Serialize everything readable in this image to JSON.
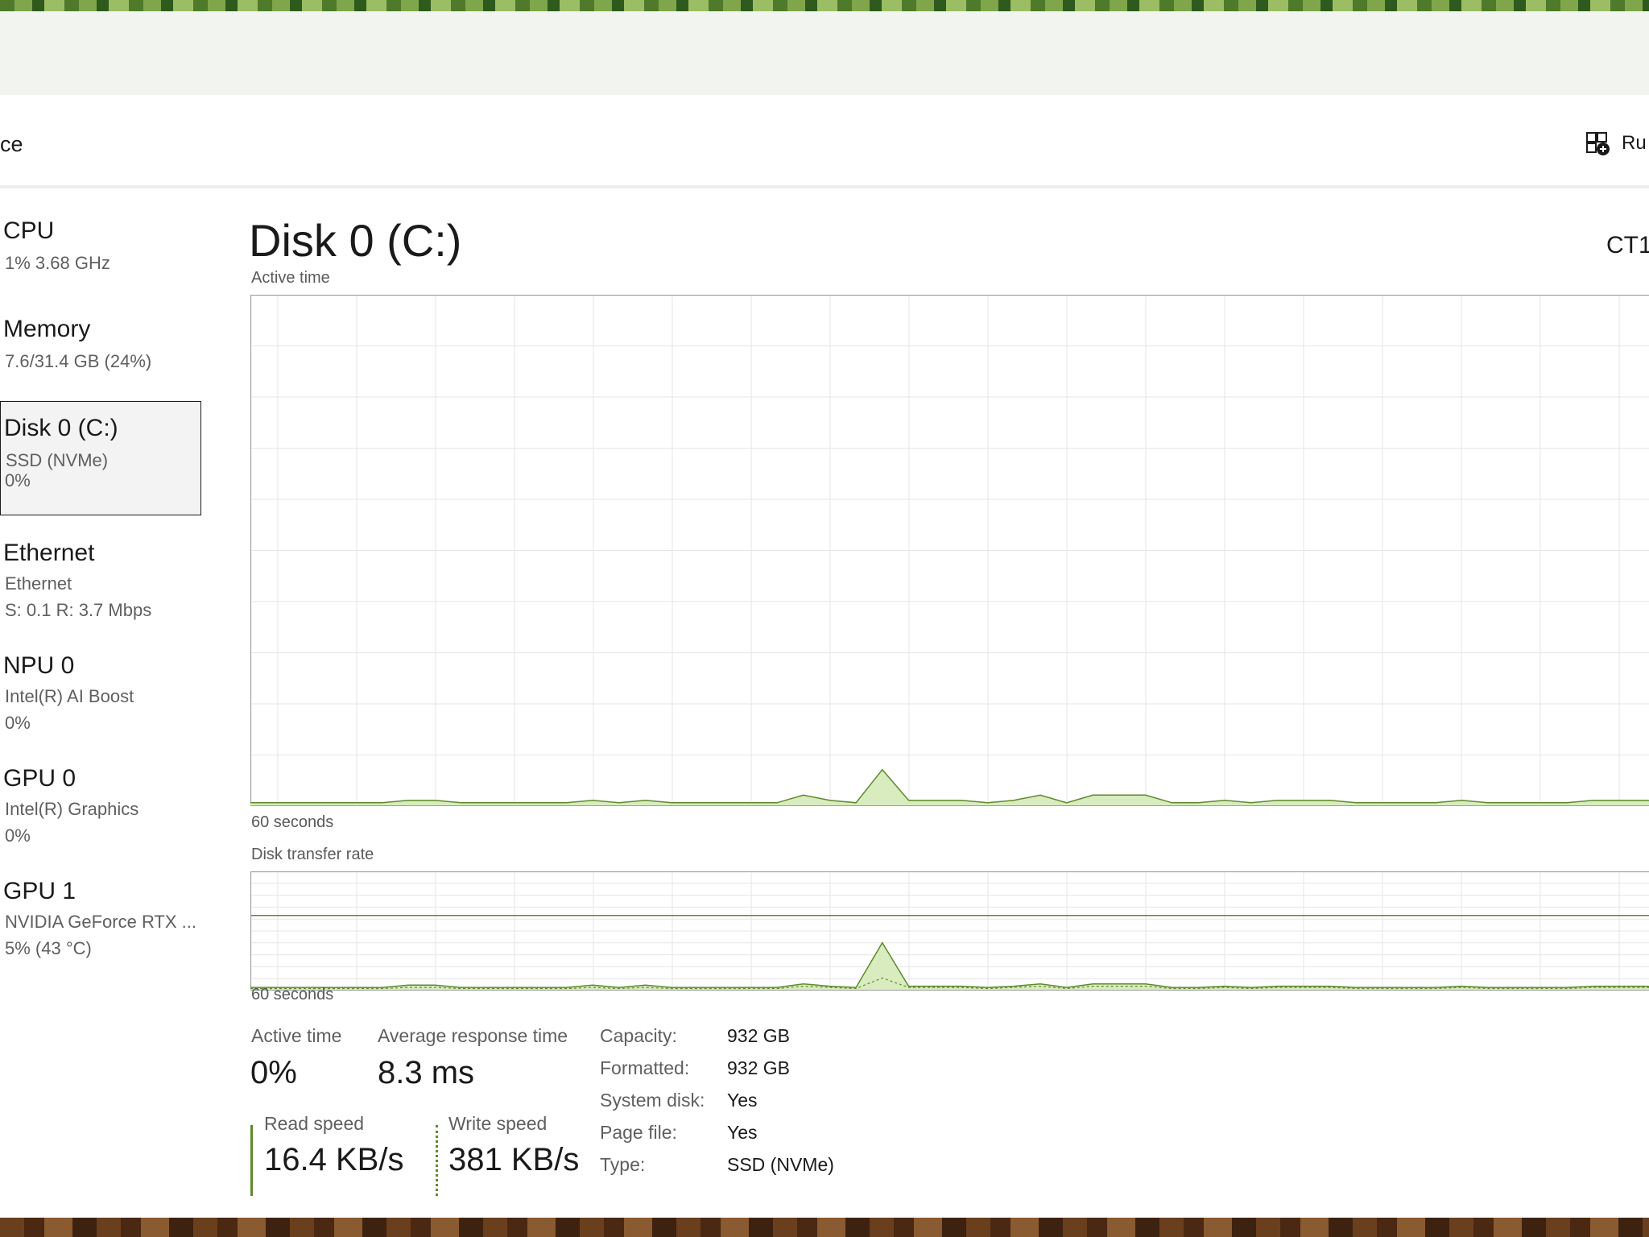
{
  "header": {
    "title": "ce",
    "run_task_label": "Ru"
  },
  "sidebar": {
    "items": [
      {
        "title": "CPU",
        "line1": "1%  3.68 GHz",
        "line2": ""
      },
      {
        "title": "Memory",
        "line1": "7.6/31.4 GB (24%)",
        "line2": ""
      },
      {
        "title": "Disk 0 (C:)",
        "line1": "SSD (NVMe)",
        "line2": "0%"
      },
      {
        "title": "Ethernet",
        "line1": "Ethernet",
        "line2": "S: 0.1  R: 3.7 Mbps"
      },
      {
        "title": "NPU 0",
        "line1": "Intel(R) AI Boost",
        "line2": "0%"
      },
      {
        "title": "GPU 0",
        "line1": "Intel(R) Graphics",
        "line2": "0%"
      },
      {
        "title": "GPU 1",
        "line1": "NVIDIA GeForce RTX ...",
        "line2": "5%  (43 °C)"
      }
    ]
  },
  "main": {
    "title": "Disk 0 (C:)",
    "model": "CT1",
    "active_chart_label": "Active time",
    "active_chart_footer": "60 seconds",
    "transfer_chart_label": "Disk transfer rate",
    "transfer_chart_footer": "60 seconds"
  },
  "stats": {
    "active_time_label": "Active time",
    "active_time_value": "0%",
    "avg_response_label": "Average response time",
    "avg_response_value": "8.3 ms",
    "read_speed_label": "Read speed",
    "read_speed_value": "16.4 KB/s",
    "write_speed_label": "Write speed",
    "write_speed_value": "381 KB/s"
  },
  "properties": [
    {
      "key": "Capacity:",
      "value": "932 GB"
    },
    {
      "key": "Formatted:",
      "value": "932 GB"
    },
    {
      "key": "System disk:",
      "value": "Yes"
    },
    {
      "key": "Page file:",
      "value": "Yes"
    },
    {
      "key": "Type:",
      "value": "SSD (NVMe)"
    }
  ],
  "colors": {
    "accent_line": "#5e8a2a",
    "accent_fill": "#d8ecbf",
    "grid": "#e6e6e6",
    "selected_bg": "#f3f3f3"
  },
  "chart_data": [
    {
      "type": "area",
      "title": "Active time",
      "xlabel": "60 seconds",
      "ylim": [
        0,
        100
      ],
      "series": [
        {
          "values": [
            0.5,
            0.5,
            0.5,
            0.5,
            0.5,
            0.5,
            1,
            1,
            0.5,
            0.5,
            0.5,
            0.5,
            0.5,
            1,
            0.5,
            1,
            0.5,
            0.5,
            0.5,
            0.5,
            0.5,
            2,
            1,
            0.5,
            7,
            1,
            1,
            1,
            0.5,
            1,
            2,
            0.5,
            2,
            2,
            2,
            0.5,
            0.5,
            1,
            0.5,
            1,
            1,
            1,
            0.5,
            0.5,
            0.5,
            0.5,
            1,
            0.5,
            0.5,
            0.5,
            0.5,
            1,
            1,
            1,
            0.5,
            0.5,
            0.5,
            6,
            0.5,
            1,
            1
          ]
        }
      ]
    },
    {
      "type": "area",
      "title": "Disk transfer rate",
      "xlabel": "60 seconds",
      "series": [
        {
          "values": [
            0.2,
            0.2,
            0.2,
            0.2,
            0.2,
            0.2,
            0.4,
            0.4,
            0.2,
            0.2,
            0.2,
            0.2,
            0.2,
            0.4,
            0.2,
            0.4,
            0.2,
            0.2,
            0.2,
            0.2,
            0.2,
            0.5,
            0.3,
            0.2,
            4,
            0.3,
            0.3,
            0.3,
            0.2,
            0.3,
            0.5,
            0.2,
            0.5,
            0.5,
            0.5,
            0.2,
            0.2,
            0.3,
            0.2,
            0.3,
            0.3,
            0.3,
            0.2,
            0.2,
            0.2,
            0.2,
            0.3,
            0.2,
            0.2,
            0.2,
            0.2,
            0.3,
            0.3,
            0.3,
            0.2,
            0.2,
            0.2,
            1.5,
            0.2,
            0.3,
            0.3
          ]
        },
        {
          "values": [
            0.1,
            0.1,
            0.1,
            0.1,
            0.1,
            0.1,
            0.2,
            0.2,
            0.1,
            0.1,
            0.1,
            0.1,
            0.1,
            0.2,
            0.1,
            0.2,
            0.1,
            0.1,
            0.1,
            0.1,
            0.1,
            0.3,
            0.2,
            0.1,
            1,
            0.2,
            0.2,
            0.2,
            0.1,
            0.2,
            0.3,
            0.1,
            0.3,
            0.3,
            0.3,
            0.1,
            0.1,
            0.2,
            0.1,
            0.2,
            0.2,
            0.2,
            0.1,
            0.1,
            0.1,
            0.1,
            0.2,
            0.1,
            0.1,
            0.1,
            0.1,
            0.2,
            0.2,
            0.2,
            0.1,
            0.1,
            0.1,
            0.6,
            0.1,
            0.2,
            0.2
          ]
        }
      ],
      "ylim": [
        0,
        10
      ]
    }
  ]
}
